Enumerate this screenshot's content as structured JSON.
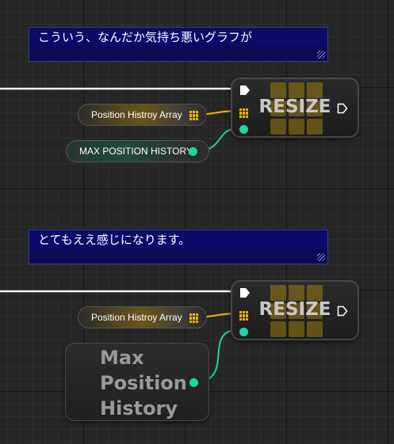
{
  "comments": [
    {
      "text": "こういう、なんだか気持ち悪いグラフが"
    },
    {
      "text": "とてもええ感じになります。"
    }
  ],
  "resize_nodes": [
    {
      "title": "RESIZE"
    },
    {
      "title": "RESIZE"
    }
  ],
  "variables": {
    "array_1": "Position Histroy Array",
    "int_1": "MAX POSITION HISTORY",
    "array_2": "Position Histroy Array",
    "big_int_lines": [
      "Max",
      "Position",
      "History"
    ]
  },
  "colors": {
    "exec_wire": "#ffffff",
    "array_pin": "#f0b400",
    "int_pin": "#1ed6a0",
    "comment_bg": "#0a0a55"
  }
}
